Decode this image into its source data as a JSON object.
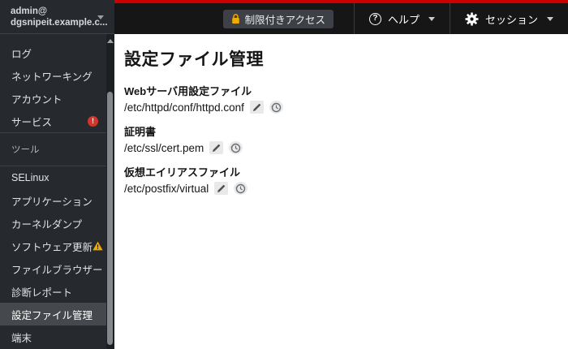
{
  "account": {
    "user": "admin@",
    "host": "dgsnipeit.example.c..."
  },
  "masthead": {
    "privileges_label": "制限付きアクセス",
    "help_label": "ヘルプ",
    "session_label": "セッション"
  },
  "sidebar": {
    "primary": [
      "ログ",
      "ネットワーキング",
      "アカウント",
      "サービス"
    ],
    "service_badge": "!",
    "tools_header": "ツール",
    "tools": [
      "SELinux",
      "アプリケーション",
      "カーネルダンプ",
      "ソフトウェア更新",
      "ファイルブラウザー",
      "診断レポート",
      "設定ファイル管理",
      "端末"
    ],
    "active_item": "設定ファイル管理"
  },
  "main": {
    "title": "設定ファイル管理",
    "files": [
      {
        "label": "Webサーバ用設定ファイル",
        "path": "/etc/httpd/conf/httpd.conf"
      },
      {
        "label": "証明書",
        "path": "/etc/ssl/cert.pem"
      },
      {
        "label": "仮想エイリアスファイル",
        "path": "/etc/postfix/virtual"
      }
    ]
  },
  "icons": {
    "caret": "chevron-down",
    "lock": "padlock",
    "help": "question-circle",
    "gear": "cog",
    "edit": "pencil",
    "revert": "history-circular-arrow",
    "alert": "red-exclamation-circle",
    "warning": "yellow-exclamation-triangle"
  },
  "colors": {
    "accent_red": "#cc0000",
    "masthead_bg": "#161616",
    "sidebar_bg": "#26292d",
    "active_item_bg": "#45494d",
    "warning_yellow": "#f0ab00",
    "alert_red": "#d2352b",
    "lock_gold": "#f0ab00"
  }
}
